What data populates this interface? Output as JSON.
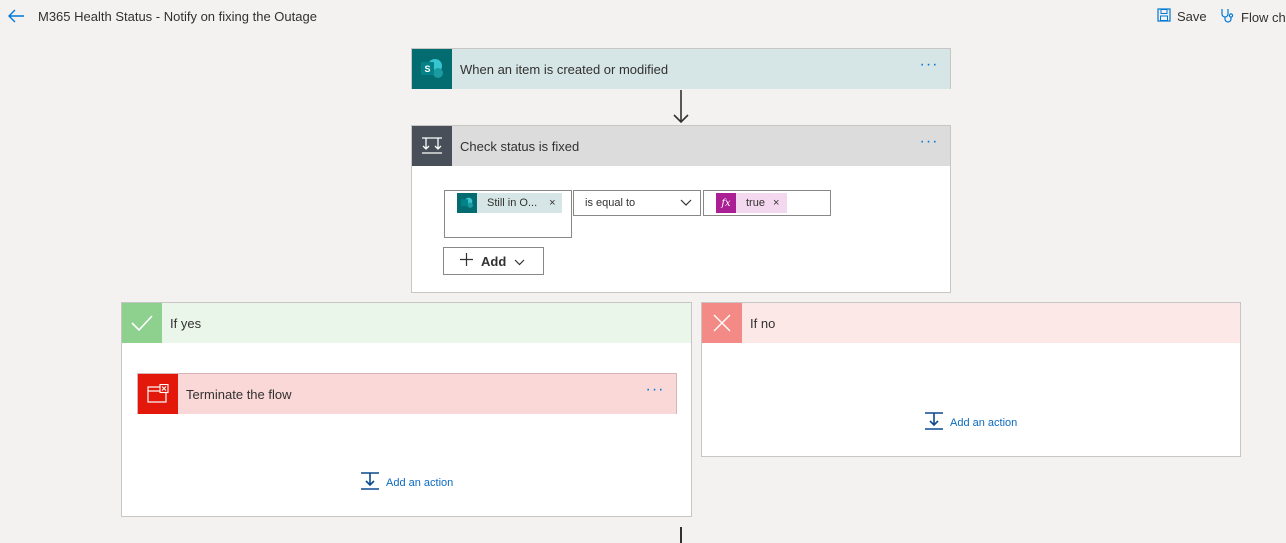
{
  "header": {
    "title": "M365 Health Status - Notify on fixing the Outage",
    "save_label": "Save",
    "flow_checker_label": "Flow che"
  },
  "trigger": {
    "title": "When an item is created or modified",
    "more_label": "···"
  },
  "condition": {
    "title": "Check status is fixed",
    "more_label": "···",
    "left_token": "Still in O...",
    "token_remove": "×",
    "operator": "is equal to",
    "right_token": "true",
    "add_label": "Add"
  },
  "branches": {
    "yes": {
      "title": "If yes",
      "action_title": "Terminate the flow",
      "more_label": "···",
      "add_action_label": "Add an action"
    },
    "no": {
      "title": "If no",
      "add_action_label": "Add an action"
    }
  },
  "colors": {
    "sharepoint": "#036c70",
    "control": "#484f58",
    "yes": "#8ed08e",
    "no": "#f48a86",
    "terminate": "#e3170a",
    "expression": "#aa1f93",
    "accent": "#0078d4"
  }
}
